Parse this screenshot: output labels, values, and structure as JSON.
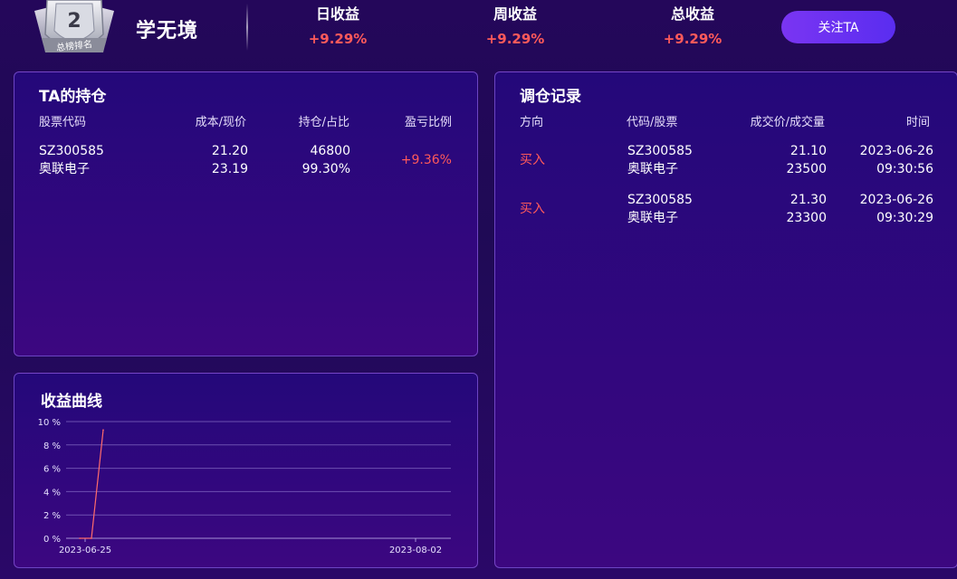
{
  "header": {
    "rank_number": "2",
    "rank_text": "总榜排名",
    "user_name": "学无境",
    "stats": [
      {
        "label": "日收益",
        "value": "+9.29%"
      },
      {
        "label": "周收益",
        "value": "+9.29%"
      },
      {
        "label": "总收益",
        "value": "+9.29%"
      }
    ],
    "follow_label": "关注TA"
  },
  "holdings": {
    "title": "TA的持仓",
    "columns": [
      "股票代码",
      "成本/现价",
      "持仓/占比",
      "盈亏比例"
    ],
    "rows": [
      {
        "code": "SZ300585",
        "name": "奥联电子",
        "cost": "21.20",
        "price": "23.19",
        "shares": "46800",
        "ratio": "99.30%",
        "pnl": "+9.36%"
      }
    ]
  },
  "trades": {
    "title": "调仓记录",
    "columns": [
      "方向",
      "代码/股票",
      "成交价/成交量",
      "时间"
    ],
    "rows": [
      {
        "direction": "买入",
        "code": "SZ300585",
        "name": "奥联电子",
        "price": "21.10",
        "volume": "23500",
        "date": "2023-06-26",
        "time": "09:30:56"
      },
      {
        "direction": "买入",
        "code": "SZ300585",
        "name": "奥联电子",
        "price": "21.30",
        "volume": "23300",
        "date": "2023-06-26",
        "time": "09:30:29"
      }
    ]
  },
  "curve": {
    "title": "收益曲线"
  },
  "chart_data": {
    "type": "line",
    "ylim": [
      0,
      10
    ],
    "y_ticks": [
      "0 %",
      "2 %",
      "4 %",
      "6 %",
      "8 %",
      "10 %"
    ],
    "x_tick_labels": [
      "2023-06-25",
      "2023-08-02"
    ],
    "x": [
      "2023-06-25",
      "2023-06-26",
      "2023-06-27"
    ],
    "values": [
      0,
      0,
      9.29
    ],
    "grid": true,
    "line_color": "#ff6b6b"
  },
  "colors": {
    "accent": "#6a30f2",
    "profit": "#ff5a5a"
  }
}
